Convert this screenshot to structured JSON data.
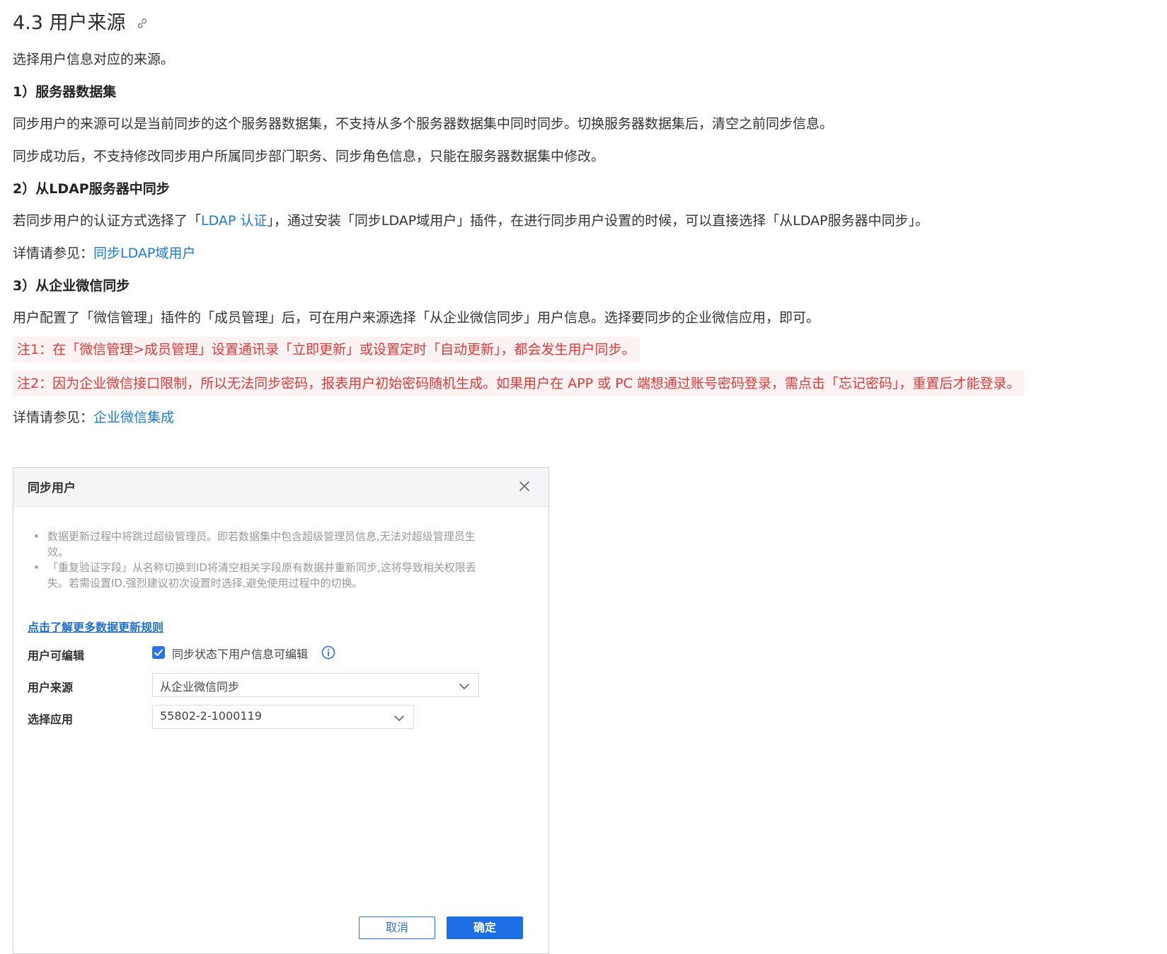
{
  "section": {
    "title": "4.3 用户来源",
    "intro": "选择用户信息对应的来源。",
    "s1": {
      "heading": "1）服务器数据集",
      "p1": "同步用户的来源可以是当前同步的这个服务器数据集，不支持从多个服务器数据集中同时同步。切换服务器数据集后，清空之前同步信息。",
      "p2": "同步成功后，不支持修改同步用户所属同步部门职务、同步角色信息，只能在服务器数据集中修改。"
    },
    "s2": {
      "heading": "2）从LDAP服务器中同步",
      "p_before": "若同步用户的认证方式选择了「",
      "p_link": "LDAP 认证",
      "p_after": "」，通过安装「同步LDAP域用户」插件，在进行同步用户设置的时候，可以直接选择「从LDAP服务器中同步」。",
      "see_label": "详情请参见：",
      "see_link": "同步LDAP域用户"
    },
    "s3": {
      "heading": "3）从企业微信同步",
      "p": "用户配置了「微信管理」插件的「成员管理」后，可在用户来源选择「从企业微信同步」用户信息。选择要同步的企业微信应用，即可。",
      "note1": "注1：在「微信管理>成员管理」设置通讯录「立即更新」或设置定时「自动更新」，都会发生用户同步。",
      "note2": "注2：因为企业微信接口限制，所以无法同步密码，报表用户初始密码随机生成。如果用户在 APP 或 PC 端想通过账号密码登录，需点击「忘记密码」，重置后才能登录。",
      "see_label": "详情请参见：",
      "see_link": "企业微信集成"
    }
  },
  "dialog": {
    "title": "同步用户",
    "tip1_line1": "数据更新过程中将跳过超级管理员。即若数据集中包含超级管理员信息,无法对超级管理员生",
    "tip1_line2": "效。",
    "tip2_line1": "「重复验证字段」从名称切换到ID将清空相关字段原有数据并重新同步,这将导致相关权限丢",
    "tip2_line2": "失。若需设置ID,强烈建议初次设置时选择,避免使用过程中的切换。",
    "rules_link": "点击了解更多数据更新规则",
    "editable_label": "用户可编辑",
    "editable_checkbox_text": "同步状态下用户信息可编辑",
    "source_label": "用户来源",
    "source_value": "从企业微信同步",
    "app_label": "选择应用",
    "app_value": "55802-2-1000119",
    "cancel": "取消",
    "ok": "确定"
  },
  "colors": {
    "link": "#1f7ad8",
    "note_text": "#e23b3b",
    "note_bg": "#fdf2f2",
    "primary": "#1e6ee6"
  }
}
